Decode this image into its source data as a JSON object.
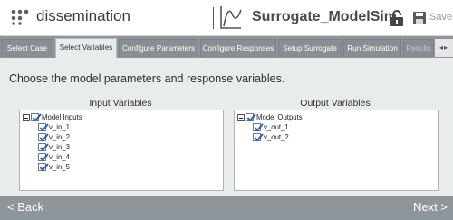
{
  "header": {
    "app_name": "dissemination",
    "model_name": "Surrogate_ModelSim",
    "save_label": "Save"
  },
  "tabs": [
    {
      "label": "Select Case",
      "active": false
    },
    {
      "label": "Select Variables",
      "active": true
    },
    {
      "label": "Configure Parameters",
      "active": false
    },
    {
      "label": "Configure Responses",
      "active": false
    },
    {
      "label": "Setup Surrogate",
      "active": false
    },
    {
      "label": "Run Simulation",
      "active": false
    },
    {
      "label": "Results",
      "active": false
    }
  ],
  "main": {
    "prompt": "Choose the model parameters and response variables.",
    "input_panel": {
      "heading": "Input Variables",
      "root_label": "Model Inputs",
      "items": [
        "v_in_1",
        "v_in_2",
        "v_in_3",
        "v_in_4",
        "v_in_5"
      ]
    },
    "output_panel": {
      "heading": "Output Variables",
      "root_label": "Model Outputs",
      "items": [
        "v_out_1",
        "v_out_2"
      ]
    }
  },
  "footer": {
    "back_label": "< Back",
    "next_label": "Next >"
  },
  "colors": {
    "tab_bar": "#8e969b",
    "content_bg": "#e9ecec",
    "check_blue": "#2d5fb8",
    "logo_gray": "#606060"
  }
}
